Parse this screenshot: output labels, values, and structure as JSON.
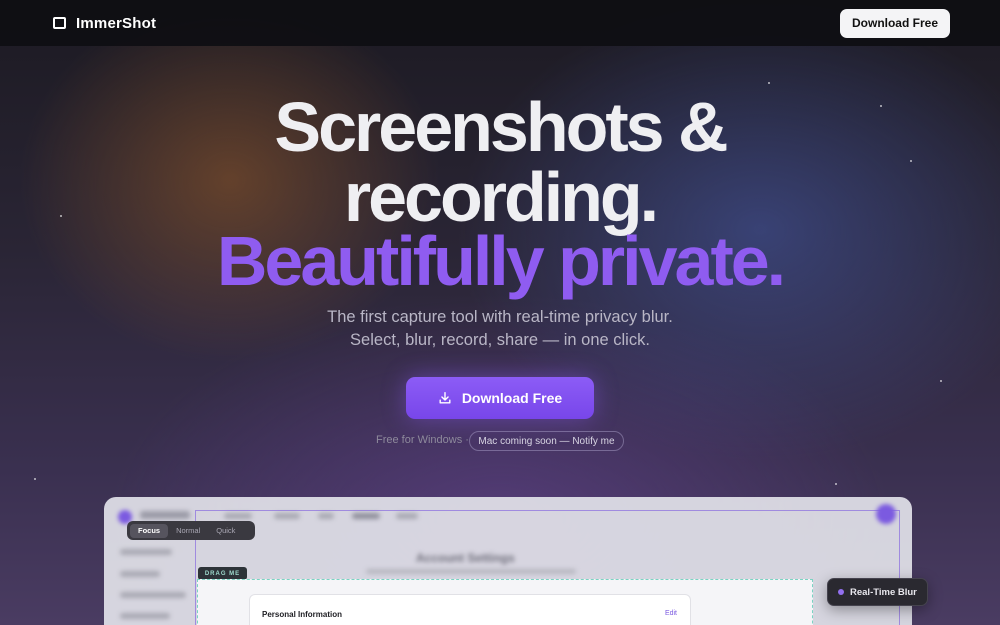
{
  "nav": {
    "brand": "ImmerShot",
    "cta_label": "Download Free"
  },
  "hero": {
    "line1": "Screenshots &",
    "line2": "recording.",
    "line3": "Beautifully private.",
    "subtitle1": "The first capture tool with real-time privacy blur.",
    "subtitle2": "Select, blur, record, share — in one click.",
    "cta_label": "Download Free",
    "free_note": "Free for Windows ·",
    "mac_pill": "Mac coming soon — Notify me"
  },
  "preview": {
    "modes": [
      "Focus",
      "Normal",
      "Quick"
    ],
    "active_mode": "Focus",
    "drag_label": "DRAG ME",
    "card_title": "Personal Information",
    "card_action": "Edit",
    "badge_label": "Real-Time Blur",
    "blurred_heading": "Account Settings"
  },
  "colors": {
    "accent": "#8f5cf0",
    "topbar": "#0e0e12",
    "drag_outline": "#7ad3c2"
  },
  "icons": {
    "brand": "square-outline-icon",
    "cta": "download-icon"
  }
}
